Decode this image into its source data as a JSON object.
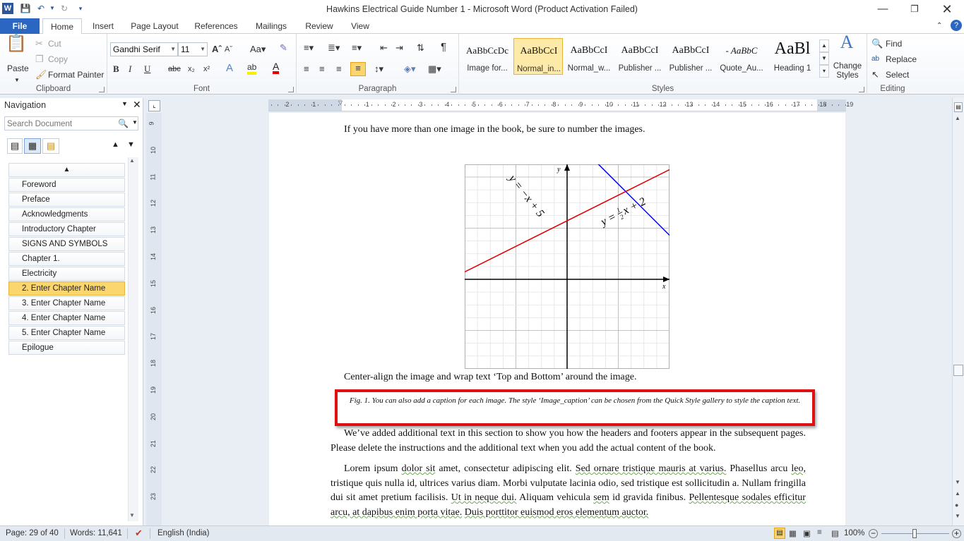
{
  "window": {
    "title": "Hawkins Electrical Guide Number 1  -  Microsoft Word (Product Activation Failed)"
  },
  "tabs": [
    "File",
    "Home",
    "Insert",
    "Page Layout",
    "References",
    "Mailings",
    "Review",
    "View"
  ],
  "clipboard": {
    "paste": "Paste",
    "cut": "Cut",
    "copy": "Copy",
    "format_painter": "Format Painter",
    "label": "Clipboard"
  },
  "font": {
    "name": "Gandhi Serif",
    "size": "11",
    "label": "Font"
  },
  "paragraph": {
    "label": "Paragraph"
  },
  "styles": {
    "label": "Styles",
    "items": [
      {
        "sample": "AaBbCcDc",
        "name": "Image for..."
      },
      {
        "sample": "AaBbCcI",
        "name": "Normal_in..."
      },
      {
        "sample": "AaBbCcI",
        "name": "Normal_w..."
      },
      {
        "sample": "AaBbCcI",
        "name": "Publisher ..."
      },
      {
        "sample": "AaBbCcI",
        "name": "Publisher ..."
      },
      {
        "sample": "- AaBbC",
        "name": "Quote_Au..."
      },
      {
        "sample": "AaBl",
        "name": "Heading 1"
      }
    ],
    "change_styles": "Change Styles"
  },
  "editing": {
    "find": "Find",
    "replace": "Replace",
    "select": "Select",
    "label": "Editing"
  },
  "navigation": {
    "title": "Navigation",
    "search_placeholder": "Search Document",
    "items": [
      "Foreword",
      "Preface",
      "Acknowledgments",
      "Introductory Chapter",
      "SIGNS AND SYMBOLS",
      "Chapter 1.",
      "Electricity",
      "2. Enter Chapter Name",
      "3. Enter Chapter Name",
      "4. Enter Chapter Name",
      "5. Enter Chapter Name",
      "Epilogue"
    ],
    "selected_index": 7
  },
  "ruler": {
    "h_ticks": [
      "2",
      "1",
      "1",
      "2",
      "3",
      "4",
      "5",
      "6",
      "7",
      "8",
      "9",
      "10",
      "11",
      "12",
      "13",
      "14",
      "15",
      "16",
      "17",
      "18",
      "19"
    ],
    "v_ticks": [
      "9",
      "10",
      "11",
      "12",
      "13",
      "14",
      "15",
      "16",
      "17",
      "18",
      "19",
      "20",
      "21",
      "22",
      "23"
    ]
  },
  "document": {
    "p1": "If you have more than one image in the book, be sure to number the images.",
    "graph": {
      "y_axis": "y",
      "x_axis": "x",
      "line1": "y = −x + 5",
      "line2_prefix": "y = ",
      "line2_frac_num": "1",
      "line2_frac_den": "2",
      "line2_suffix": "x + 2",
      "line1_color": "#0000ff",
      "line2_color": "#e00000"
    },
    "p2": "Center-align the image and wrap text ‘Top and Bottom’ around the image.",
    "caption": "Fig. 1. You can also add a caption for each image. The style ‘Image_caption’ can be chosen from the Quick Style gallery to style the caption text.",
    "p3": "We’ve added additional text in this section to show you how the headers and footers appear in the subsequent pages. Please delete the instructions and the additional text when you add the actual content of the book.",
    "p4a": "Lorem ipsum ",
    "p4_sq1": "dolor sit",
    "p4b": " amet, consectetur adipiscing elit. ",
    "p4_sq2": "Sed ornare tristique mauris at varius.",
    "p4c": " Phasellus arcu ",
    "p4_sq3": "leo,",
    "p4d": " tristique quis nulla id, ultrices varius diam. Morbi vulputate lacinia odio, sed tristique est sollicitudin a. Nullam fringilla dui sit amet pretium facilisis. ",
    "p4_sq4": "Ut in neque dui.",
    "p4e": " Aliquam vehicula ",
    "p4_sq5": "sem",
    "p4f": " id gravida finibus. ",
    "p4_sq6": "Pellentesque sodales efficitur arcu, at dapibus enim porta vitae.",
    "p4g": " ",
    "p4_sq7": "Duis porttitor euismod eros elementum auctor."
  },
  "status": {
    "page": "Page: 29 of 40",
    "words": "Words: 11,641",
    "language": "English (India)",
    "zoom": "100%"
  }
}
